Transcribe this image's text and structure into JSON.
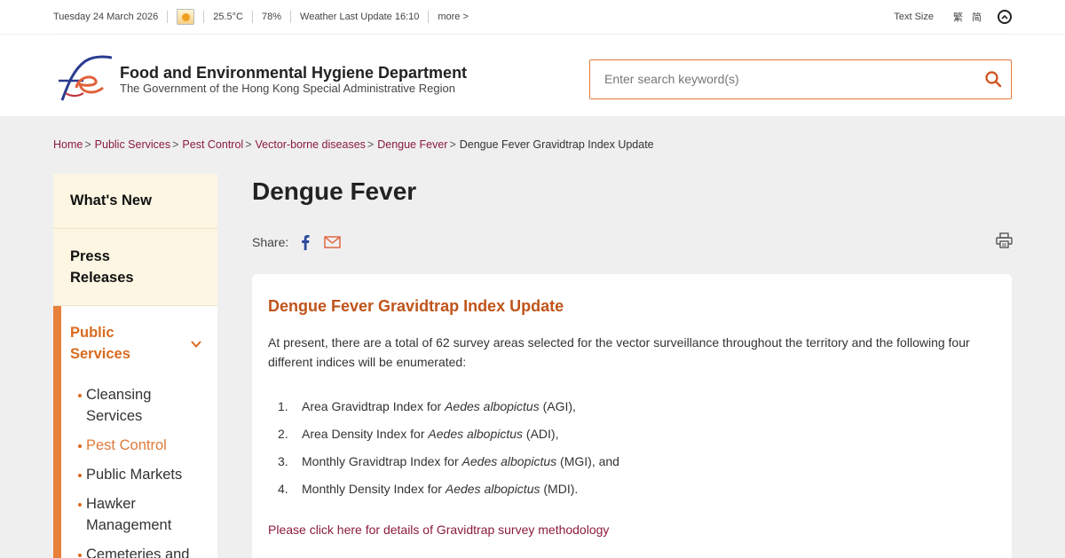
{
  "topbar": {
    "date": "Tuesday 24 March 2026",
    "weather_icon": "partly-sunny-icon",
    "temperature": "25.5°C",
    "humidity": "78%",
    "weather_update": "Weather Last Update 16:10",
    "more": "more >",
    "text_size": "Text Size",
    "lang_traditional": "繁",
    "lang_simplified": "简",
    "back_to_top_icon": "chevron-up-circle-icon"
  },
  "header": {
    "logo_icon": "fehd-logo",
    "title": "Food and Environmental Hygiene Department",
    "subtitle": "The Government of the Hong Kong Special Administrative Region",
    "search_placeholder": "Enter search keyword(s)",
    "search_icon": "search-icon"
  },
  "breadcrumb": [
    "Home",
    "Public Services",
    "Pest Control",
    "Vector-borne diseases",
    "Dengue Fever",
    "Dengue Fever Gravidtrap Index Update"
  ],
  "sidebar": {
    "whats_new": "What's New",
    "press_line1": "Press",
    "press_line2": "Releases",
    "public_line1": "Public",
    "public_line2": "Services",
    "public_expanded": true,
    "items": [
      {
        "label": "Cleansing",
        "label2": "Services",
        "active": false
      },
      {
        "label": "Pest Control",
        "active": true
      },
      {
        "label": "Public Markets",
        "active": false
      },
      {
        "label": "Hawker",
        "label2": "Management",
        "active": false
      },
      {
        "label": "Cemeteries and",
        "active": false
      }
    ]
  },
  "main": {
    "title": "Dengue Fever",
    "share_label": "Share:",
    "card_title": "Dengue Fever Gravidtrap Index Update",
    "intro": "At present, there are a total of 62 survey areas selected for the vector surveillance throughout the territory and the following four different indices will be enumerated:",
    "indices": [
      {
        "num": "1.",
        "pre": "Area Gravidtrap Index for ",
        "species": "Aedes albopictus",
        "post": " (AGI),"
      },
      {
        "num": "2.",
        "pre": "Area Density Index for ",
        "species": "Aedes albopictus",
        "post": " (ADI),"
      },
      {
        "num": "3.",
        "pre": "Monthly Gravidtrap Index for ",
        "species": "Aedes albopictus",
        "post": " (MGI), and"
      },
      {
        "num": "4.",
        "pre": "Monthly Density Index for ",
        "species": "Aedes albopictus",
        "post": " (MDI)."
      }
    ],
    "methodology_link": "Please click here for details of Gravidtrap survey methodology"
  },
  "colors": {
    "accent_orange": "#e07a3a",
    "link_maroon": "#8b1c3b",
    "sidebar_cream": "#fdf6e3",
    "page_bg": "#efeff0"
  }
}
